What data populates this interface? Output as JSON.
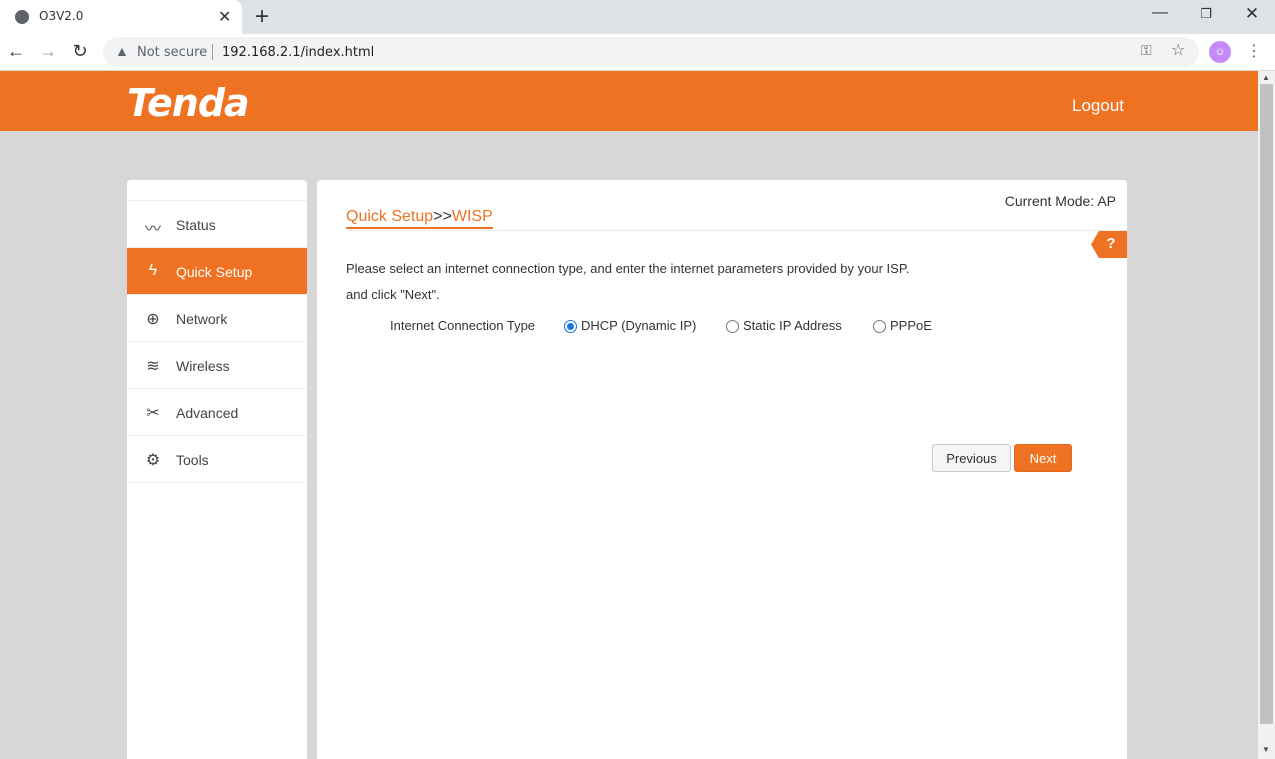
{
  "browser": {
    "tab_title": "O3V2.0",
    "tab_close": "✕",
    "new_tab": "+",
    "security_label": "Not secure",
    "url": "192.168.2.1/index.html",
    "avatar_glyph": "☺"
  },
  "header": {
    "brand": "Tenda",
    "logout": "Logout"
  },
  "sidebar": {
    "items": [
      {
        "label": "Status",
        "icon": "pulse-icon",
        "glyph": "〰",
        "active": false
      },
      {
        "label": "Quick Setup",
        "icon": "bolt-icon",
        "glyph": "ϟ",
        "active": true
      },
      {
        "label": "Network",
        "icon": "globe-icon",
        "glyph": "⊕",
        "active": false
      },
      {
        "label": "Wireless",
        "icon": "wifi-icon",
        "glyph": "≋",
        "active": false
      },
      {
        "label": "Advanced",
        "icon": "tools-icon",
        "glyph": "✂",
        "active": false
      },
      {
        "label": "Tools",
        "icon": "gears-icon",
        "glyph": "⚙",
        "active": false
      }
    ]
  },
  "main": {
    "current_mode": "Current Mode: AP",
    "crumb_first": "Quick Setup",
    "crumb_sep": ">>",
    "crumb_second": "WISP",
    "help": "?",
    "instruction_line1": "Please select an internet connection type, and enter the internet parameters provided by your ISP.",
    "instruction_line2": "and click \"Next\".",
    "connection_label": "Internet Connection Type",
    "options": [
      {
        "label": "DHCP (Dynamic IP)",
        "checked": true
      },
      {
        "label": "Static IP Address",
        "checked": false
      },
      {
        "label": "PPPoE",
        "checked": false
      }
    ],
    "previous_button": "Previous",
    "next_button": "Next"
  },
  "colors": {
    "brand_orange": "#ee7222",
    "radio_blue": "#1a73e8"
  }
}
